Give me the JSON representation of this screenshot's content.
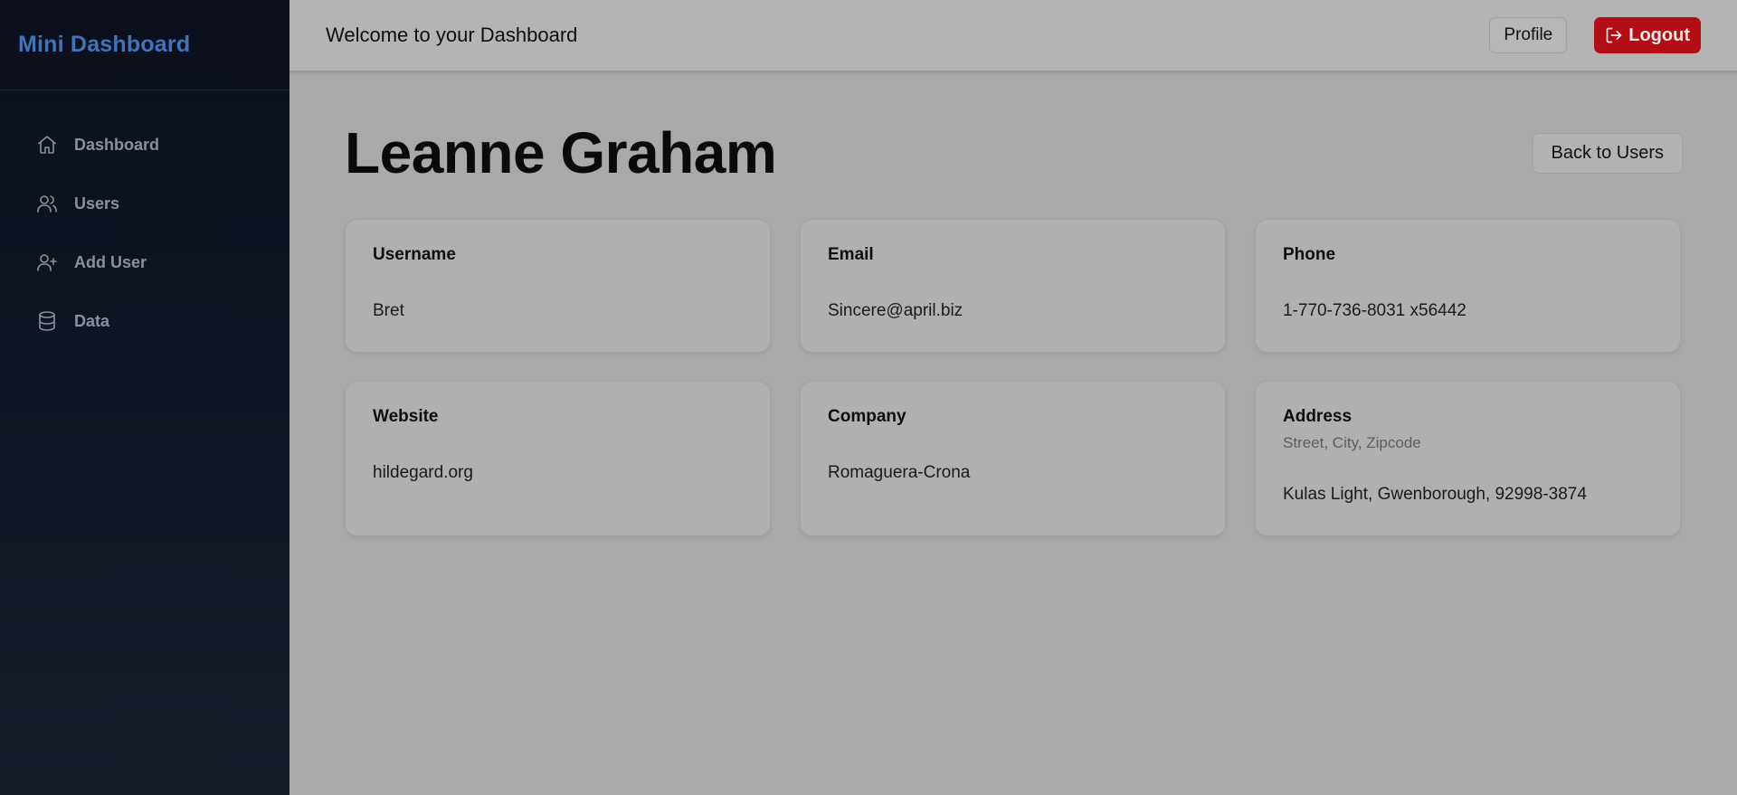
{
  "sidebar": {
    "brand": "Mini Dashboard",
    "items": [
      {
        "label": "Dashboard",
        "icon": "home-icon"
      },
      {
        "label": "Users",
        "icon": "users-icon"
      },
      {
        "label": "Add User",
        "icon": "user-plus-icon"
      },
      {
        "label": "Data",
        "icon": "database-icon"
      }
    ]
  },
  "header": {
    "welcome": "Welcome to your Dashboard",
    "profile_label": "Profile",
    "logout_label": "Logout"
  },
  "main": {
    "user_name": "Leanne Graham",
    "back_label": "Back to Users",
    "cards": {
      "username": {
        "label": "Username",
        "value": "Bret"
      },
      "email": {
        "label": "Email",
        "value": "Sincere@april.biz"
      },
      "phone": {
        "label": "Phone",
        "value": "1-770-736-8031 x56442"
      },
      "website": {
        "label": "Website",
        "value": "hildegard.org"
      },
      "company": {
        "label": "Company",
        "value": "Romaguera-Crona"
      },
      "address": {
        "label": "Address",
        "sublabel": "Street, City, Zipcode",
        "value": "Kulas Light, Gwenborough, 92998-3874"
      }
    }
  },
  "colors": {
    "brand": "#3f74ba",
    "logout": "#b30e16",
    "sidebar_bg": "#0b101c",
    "page_bg": "#a9a9ab"
  }
}
